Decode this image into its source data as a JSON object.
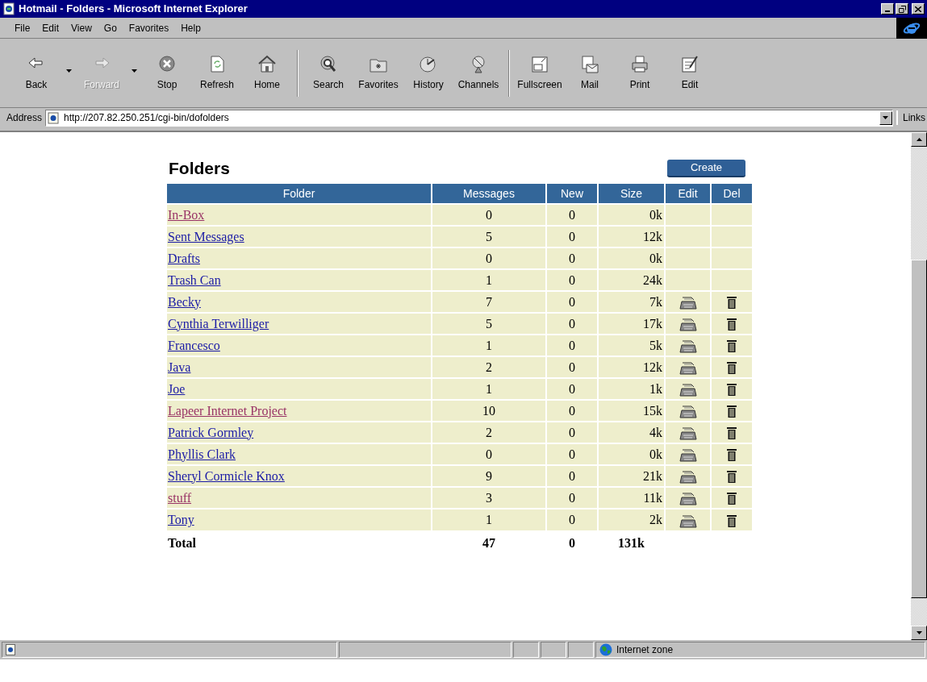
{
  "window": {
    "title": "Hotmail - Folders - Microsoft Internet Explorer"
  },
  "menu": [
    "File",
    "Edit",
    "View",
    "Go",
    "Favorites",
    "Help"
  ],
  "toolbar": {
    "groups": [
      [
        {
          "kind": "back",
          "label": "Back",
          "disabled": false,
          "dropdown": true
        },
        {
          "kind": "forward",
          "label": "Forward",
          "disabled": true,
          "dropdown": true
        },
        {
          "kind": "stop",
          "label": "Stop",
          "disabled": false,
          "dropdown": false
        },
        {
          "kind": "refresh",
          "label": "Refresh",
          "disabled": false,
          "dropdown": false
        },
        {
          "kind": "home",
          "label": "Home",
          "disabled": false,
          "dropdown": false
        }
      ],
      [
        {
          "kind": "search",
          "label": "Search",
          "disabled": false,
          "dropdown": false
        },
        {
          "kind": "favorites",
          "label": "Favorites",
          "disabled": false,
          "dropdown": false
        },
        {
          "kind": "history",
          "label": "History",
          "disabled": false,
          "dropdown": false
        },
        {
          "kind": "channels",
          "label": "Channels",
          "disabled": false,
          "dropdown": false
        }
      ],
      [
        {
          "kind": "fullscreen",
          "label": "Fullscreen",
          "disabled": false,
          "dropdown": false
        },
        {
          "kind": "mail",
          "label": "Mail",
          "disabled": false,
          "dropdown": false
        },
        {
          "kind": "print",
          "label": "Print",
          "disabled": false,
          "dropdown": false
        },
        {
          "kind": "edit",
          "label": "Edit",
          "disabled": false,
          "dropdown": false
        }
      ]
    ]
  },
  "address_bar": {
    "label": "Address",
    "value": "http://207.82.250.251/cgi-bin/dofolders",
    "links": "Links"
  },
  "page": {
    "heading": "Folders",
    "create_button": "Create",
    "table": {
      "columns": [
        "Folder",
        "Messages",
        "New",
        "Size",
        "Edit",
        "Del"
      ],
      "rows": [
        {
          "name": "In-Box",
          "messages": "0",
          "new": "0",
          "size": "0k",
          "visited": true,
          "editable": false
        },
        {
          "name": "Sent Messages",
          "messages": "5",
          "new": "0",
          "size": "12k",
          "visited": false,
          "editable": false
        },
        {
          "name": "Drafts",
          "messages": "0",
          "new": "0",
          "size": "0k",
          "visited": false,
          "editable": false
        },
        {
          "name": "Trash Can",
          "messages": "1",
          "new": "0",
          "size": "24k",
          "visited": false,
          "editable": false
        },
        {
          "name": "Becky",
          "messages": "7",
          "new": "0",
          "size": "7k",
          "visited": false,
          "editable": true
        },
        {
          "name": "Cynthia Terwilliger",
          "messages": "5",
          "new": "0",
          "size": "17k",
          "visited": false,
          "editable": true
        },
        {
          "name": "Francesco",
          "messages": "1",
          "new": "0",
          "size": "5k",
          "visited": false,
          "editable": true
        },
        {
          "name": "Java",
          "messages": "2",
          "new": "0",
          "size": "12k",
          "visited": false,
          "editable": true
        },
        {
          "name": "Joe",
          "messages": "1",
          "new": "0",
          "size": "1k",
          "visited": false,
          "editable": true
        },
        {
          "name": "Lapeer Internet Project",
          "messages": "10",
          "new": "0",
          "size": "15k",
          "visited": true,
          "editable": true
        },
        {
          "name": "Patrick Gormley",
          "messages": "2",
          "new": "0",
          "size": "4k",
          "visited": false,
          "editable": true
        },
        {
          "name": "Phyllis Clark",
          "messages": "0",
          "new": "0",
          "size": "0k",
          "visited": false,
          "editable": true
        },
        {
          "name": "Sheryl Cormicle Knox",
          "messages": "9",
          "new": "0",
          "size": "21k",
          "visited": false,
          "editable": true
        },
        {
          "name": "stuff",
          "messages": "3",
          "new": "0",
          "size": "11k",
          "visited": true,
          "editable": true
        },
        {
          "name": "Tony",
          "messages": "1",
          "new": "0",
          "size": "2k",
          "visited": false,
          "editable": true
        }
      ],
      "total": {
        "label": "Total",
        "messages": "47",
        "new": "0",
        "size": "131k"
      }
    }
  },
  "status_bar": {
    "zone": "Internet zone"
  }
}
